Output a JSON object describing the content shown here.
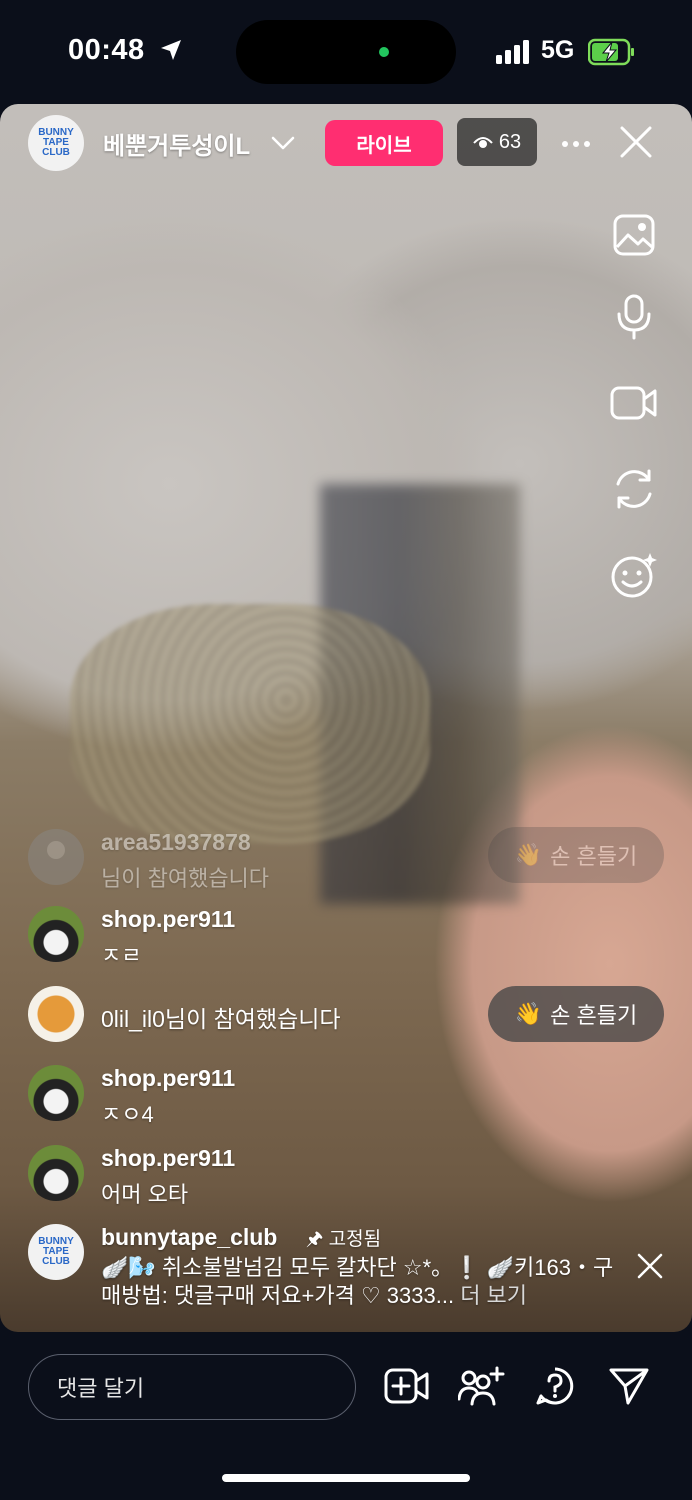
{
  "status_bar": {
    "time": "00:48",
    "network": "5G"
  },
  "host": {
    "name": "베뿐거투성이L",
    "avatar_text": "BUNNY TAPE CLUB"
  },
  "live": {
    "badge": "라이브",
    "viewer_count": "63"
  },
  "comments": [
    {
      "user": "area51937878",
      "text": "님이 참여했습니다",
      "faded": true,
      "wave_label": "손 흔들기"
    },
    {
      "user": "shop.per911",
      "text": "ㅈㄹ"
    },
    {
      "line": "0lil_il0님이 참여했습니다",
      "wave_label": "손 흔들기"
    },
    {
      "user": "shop.per911",
      "text": "ㅈㅇ4"
    },
    {
      "user": "shop.per911",
      "text": "어머 오타"
    }
  ],
  "pinned": {
    "user": "bunnytape_club",
    "pinned_label": "고정됨",
    "line1": "🪽🌬️ 취소불발넘김 모두 칼차단 ☆*。❕ 🪽키163・구",
    "line2": "매방법: 댓글구매 저요+가격 ♡ 3333...",
    "more": "더 보기"
  },
  "bottom_bar": {
    "comment_placeholder": "댓글 달기"
  },
  "icons": [
    "location-arrow-icon",
    "signal-icon",
    "battery-charging-icon",
    "chevron-down-icon",
    "eye-icon",
    "more-icon",
    "close-icon",
    "image-icon",
    "microphone-icon",
    "video-camera-icon",
    "switch-camera-icon",
    "effects-face-icon",
    "wave-hand-icon",
    "pin-icon",
    "add-video-icon",
    "add-guest-icon",
    "question-icon",
    "send-icon"
  ],
  "colors": {
    "live_badge": "#ff2e71",
    "background": "#0b0f1a",
    "island_dot": "#22c55e"
  }
}
